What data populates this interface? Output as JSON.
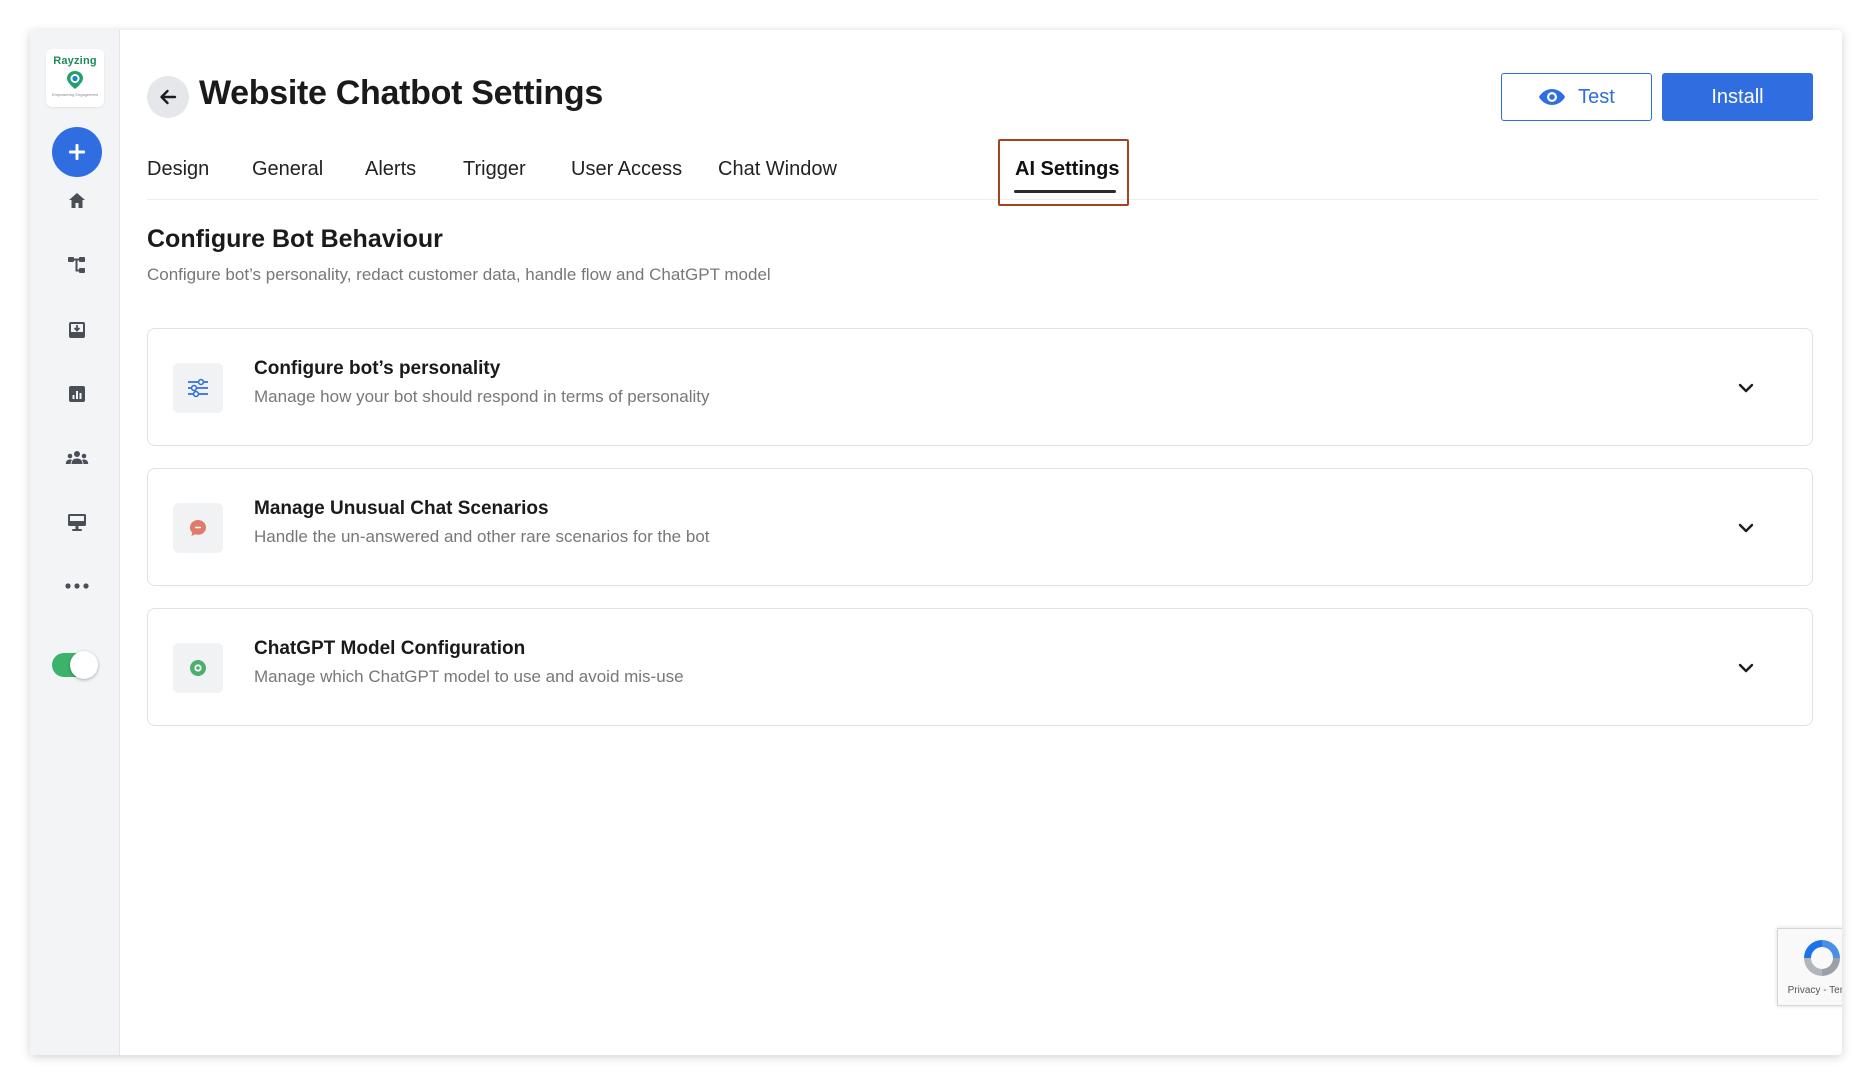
{
  "app": {
    "logo_text": "Rayzing",
    "logo_subtext": "Empowering Engagement"
  },
  "header": {
    "title": "Website Chatbot Settings",
    "test_label": "Test",
    "install_label": "Install"
  },
  "tabs": [
    {
      "label": "Design"
    },
    {
      "label": "General"
    },
    {
      "label": "Alerts"
    },
    {
      "label": "Trigger"
    },
    {
      "label": "User Access"
    },
    {
      "label": "Chat Window"
    },
    {
      "label": "AI Settings",
      "active": true
    }
  ],
  "section": {
    "title": "Configure Bot Behaviour",
    "subtitle": "Configure bot’s personality, redact customer data, handle flow and ChatGPT model"
  },
  "cards": [
    {
      "title": "Configure bot’s personality",
      "description": "Manage how your bot should respond in terms of personality",
      "icon": "sliders-icon"
    },
    {
      "title": "Manage Unusual Chat Scenarios",
      "description": "Handle the un-answered and other rare scenarios for the bot",
      "icon": "chat-bubble-icon"
    },
    {
      "title": "ChatGPT Model Configuration",
      "description": "Manage which ChatGPT model to use and avoid mis-use",
      "icon": "model-icon"
    }
  ],
  "sidebar": {
    "items": [
      "home-icon",
      "flow-icon",
      "inbox-icon",
      "analytics-icon",
      "team-icon",
      "display-icon",
      "more-icon"
    ]
  },
  "recaptcha": {
    "text": "Privacy - Terms"
  },
  "colors": {
    "primary": "#2f6de1",
    "active_tab_highlight": "#a2451f",
    "toggle_on": "#3db26b",
    "scenario_icon": "#e07a6a",
    "model_icon": "#4caf6d"
  }
}
